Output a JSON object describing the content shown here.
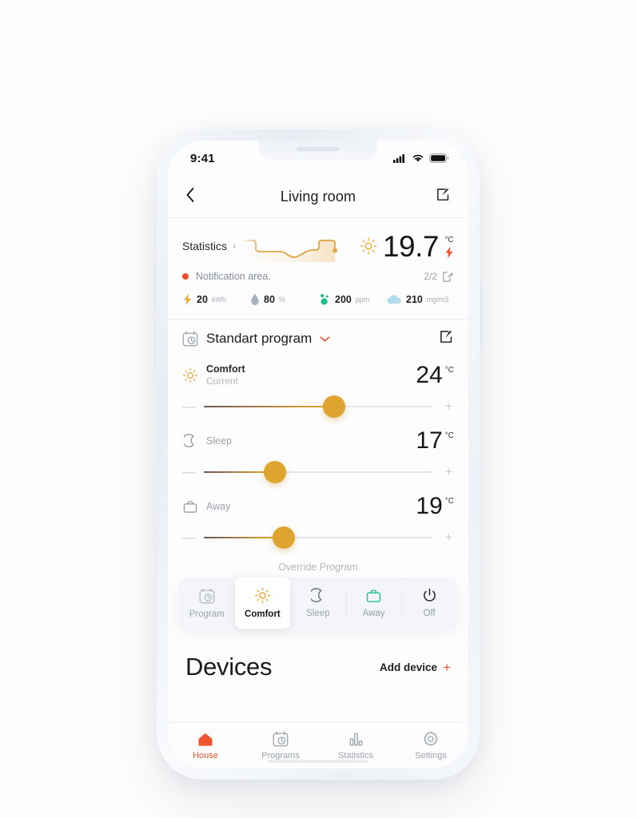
{
  "statusbar": {
    "time": "9:41",
    "signal_icon": "cellular-signal-icon",
    "wifi_icon": "wifi-icon",
    "battery_icon": "battery-icon"
  },
  "navbar": {
    "back_icon": "chevron-left-icon",
    "title": "Living room",
    "edit_icon": "edit-pencil-icon"
  },
  "stats": {
    "label": "Statistics",
    "chevron": "›",
    "sparkline_color": "#e0a84a",
    "sun_icon": "sun-icon",
    "temperature": "19.7",
    "unit": "°C",
    "bolt_icon": "lightning-bolt-icon",
    "bolt_color": "#f0522d",
    "notification": {
      "dot_color": "#f2502c",
      "text": "Notification area.",
      "count": "2/2",
      "open_icon": "external-link-icon"
    },
    "metrics": [
      {
        "icon": "lightning-bolt-icon",
        "color": "#f0a92e",
        "value": "20",
        "unit": "kWh"
      },
      {
        "icon": "water-drop-icon",
        "color": "#a8b5c0",
        "value": "80",
        "unit": "%"
      },
      {
        "icon": "co2-dots-icon",
        "color": "#1fbf88",
        "value": "200",
        "unit": "ppm"
      },
      {
        "icon": "cloud-icon",
        "color": "#b3dcea",
        "value": "210",
        "unit": "mg/m3"
      }
    ]
  },
  "program": {
    "calendar_icon": "calendar-clock-icon",
    "title": "Standart program",
    "caret": "˅",
    "caret_color": "#e04e2d",
    "edit_icon": "edit-pencil-icon",
    "modes": [
      {
        "icon": "sun-icon",
        "icon_color": "#e8a33a",
        "name": "Comfort",
        "sub": "Current",
        "temp": "24",
        "unit": "°C",
        "slider_percent": 57,
        "minus": "—",
        "plus": "+"
      },
      {
        "icon": "moon-icon",
        "icon_color": "#8f98a2",
        "name": "Sleep",
        "sub": "",
        "temp": "17",
        "unit": "°C",
        "slider_percent": 31,
        "minus": "—",
        "plus": "+"
      },
      {
        "icon": "briefcase-icon",
        "icon_color": "#8f98a2",
        "name": "Away",
        "sub": "",
        "temp": "19",
        "unit": "°C",
        "slider_percent": 35,
        "minus": "—",
        "plus": "+"
      }
    ],
    "override_label": "Override Program",
    "segments": [
      {
        "icon": "calendar-clock-icon",
        "label": "Program",
        "active": false,
        "icon_color": "#b3bac2"
      },
      {
        "icon": "sun-icon",
        "label": "Comfort",
        "active": true,
        "icon_color": "#eda72e"
      },
      {
        "icon": "moon-icon",
        "label": "Sleep",
        "active": false,
        "icon_color": "#6f7780"
      },
      {
        "icon": "briefcase-icon",
        "label": "Away",
        "active": false,
        "icon_color": "#1fbf88"
      },
      {
        "icon": "power-icon",
        "label": "Off",
        "active": false,
        "icon_color": "#22262b"
      }
    ]
  },
  "devices": {
    "title": "Devices",
    "add_label": "Add device",
    "add_icon": "plus-icon",
    "add_icon_color": "#f0522d"
  },
  "tabbar": {
    "items": [
      {
        "icon": "home-icon",
        "label": "House",
        "active": true
      },
      {
        "icon": "calendar-clock-icon",
        "label": "Programs",
        "active": false
      },
      {
        "icon": "bar-chart-icon",
        "label": "Statistics",
        "active": false
      },
      {
        "icon": "gear-icon",
        "label": "Settings",
        "active": false
      }
    ],
    "active_color": "#ef5630",
    "inactive_color": "#9aa2ab"
  }
}
